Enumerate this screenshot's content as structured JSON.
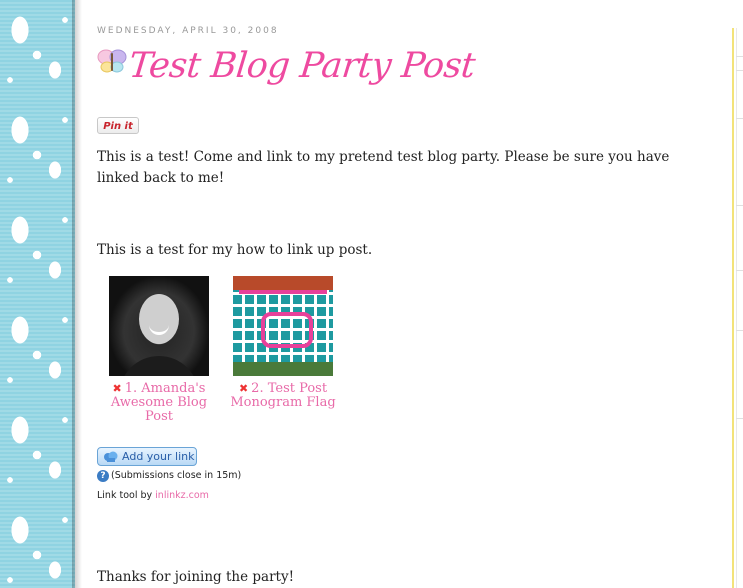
{
  "post": {
    "date": "WEDNESDAY, APRIL 30, 2008",
    "title": "Test Blog Party Post",
    "pin_label": "Pin it",
    "paragraph_1": "This is a test! Come and link to my pretend test blog party. Please be sure you have linked back to me!",
    "paragraph_2": "This is a test for my how to link up post.",
    "paragraph_3": "Thanks for joining the party!"
  },
  "links": [
    {
      "number": "1.",
      "label": "Amanda's Awesome Blog Post",
      "icon": "delete-x-icon"
    },
    {
      "number": "2.",
      "label": "Test Post Monogram Flag",
      "icon": "delete-x-icon"
    }
  ],
  "linkup": {
    "add_button_label": "Add your link",
    "submissions_text": "(Submissions close in 15m)",
    "tool_prefix": "Link tool by ",
    "tool_link": "inlinkz.com"
  },
  "colors": {
    "title_pink": "#ee4aa0",
    "link_pink": "#e86aa8",
    "pattern_blue": "#8fd3e2"
  }
}
